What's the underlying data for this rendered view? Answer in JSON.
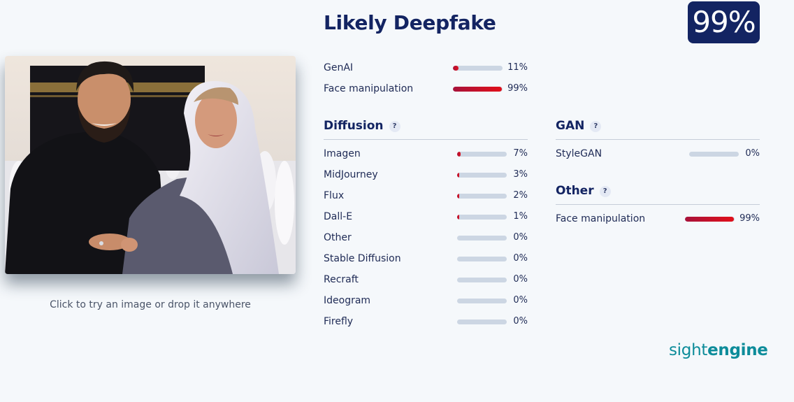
{
  "upload": {
    "hint": "Click to try an image or drop it anywhere"
  },
  "result": {
    "verdict": "Likely Deepfake",
    "score": "99%"
  },
  "summary": [
    {
      "label": "GenAI",
      "pct": "11%",
      "level": 0.11
    },
    {
      "label": "Face manipulation",
      "pct": "99%",
      "level": 0.99
    }
  ],
  "sections": {
    "diffusion": {
      "title": "Diffusion",
      "help": "?",
      "items": [
        {
          "label": "Imagen",
          "pct": "7%",
          "level": 0.07
        },
        {
          "label": "MidJourney",
          "pct": "3%",
          "level": 0.03
        },
        {
          "label": "Flux",
          "pct": "2%",
          "level": 0.02
        },
        {
          "label": "Dall-E",
          "pct": "1%",
          "level": 0.01
        },
        {
          "label": "Other",
          "pct": "0%",
          "level": 0
        },
        {
          "label": "Stable Diffusion",
          "pct": "0%",
          "level": 0
        },
        {
          "label": "Recraft",
          "pct": "0%",
          "level": 0
        },
        {
          "label": "Ideogram",
          "pct": "0%",
          "level": 0
        },
        {
          "label": "Firefly",
          "pct": "0%",
          "level": 0
        }
      ]
    },
    "gan": {
      "title": "GAN",
      "help": "?",
      "items": [
        {
          "label": "StyleGAN",
          "pct": "0%",
          "level": 0
        }
      ]
    },
    "other": {
      "title": "Other",
      "help": "?",
      "items": [
        {
          "label": "Face manipulation",
          "pct": "99%",
          "level": 0.99
        }
      ]
    }
  },
  "brand": {
    "light": "sight",
    "bold": "engine"
  },
  "colors": {
    "navy": "#132462",
    "bar_track": "#ccd6e3",
    "bar_fill_start": "#a8123a",
    "bar_fill_end": "#e1101a",
    "brand_teal": "#0d8c9a"
  }
}
